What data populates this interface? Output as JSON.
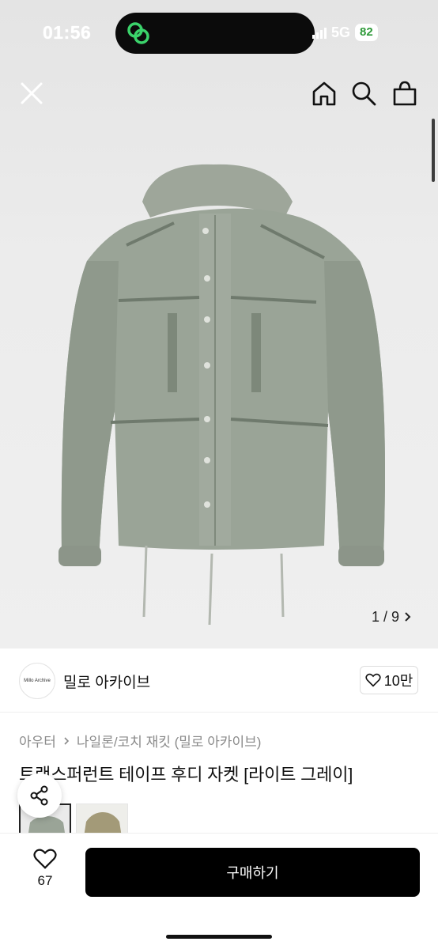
{
  "status_bar": {
    "time": "01:56",
    "carrier": "5G",
    "battery": "82"
  },
  "header": {
    "close_icon": "close-icon",
    "home_icon": "home-icon",
    "search_icon": "search-icon",
    "bag_icon": "shopping-bag-icon"
  },
  "gallery": {
    "counter": "1 / 9"
  },
  "seller": {
    "logo_text": "Millo Archive",
    "name": "밀로 아카이브",
    "likes": "10만"
  },
  "product": {
    "breadcrumb": [
      "아우터",
      "나일론/코치 재킷 (밀로 아카이브)"
    ],
    "title": "트랜스퍼런트 테이프 후디 자켓 [라이트 그레이]"
  },
  "footer": {
    "wish_count": "67",
    "buy_label": "구매하기"
  },
  "colors": {
    "accent": "#000000",
    "jacket": "#9aa497",
    "jacket_alt": "#a39a78"
  }
}
